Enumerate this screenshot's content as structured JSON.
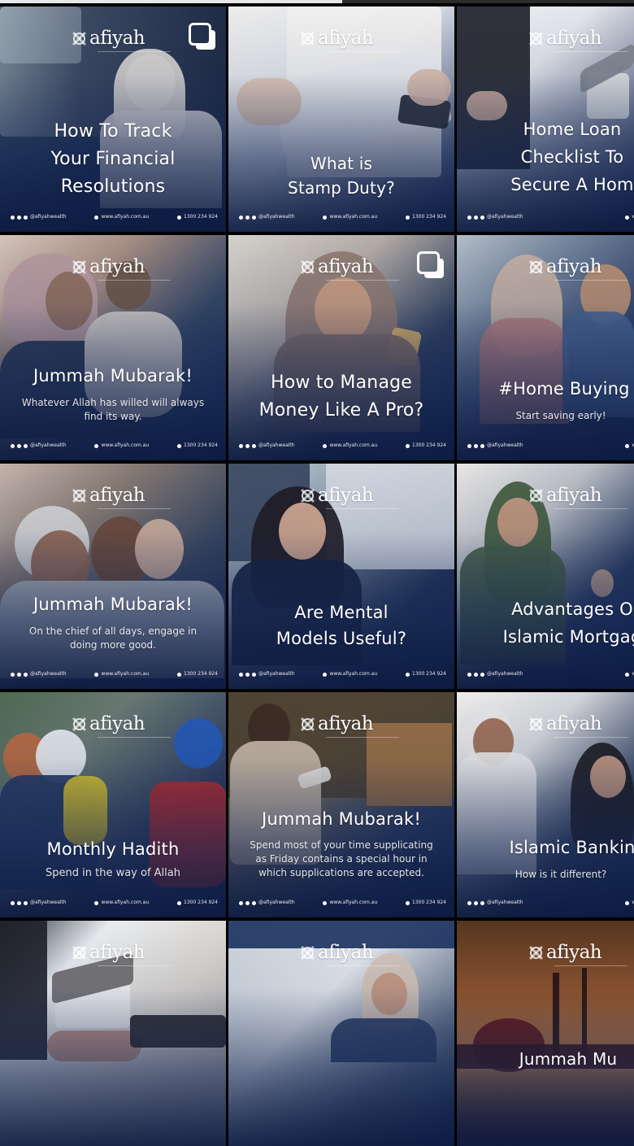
{
  "screen": {
    "progress_fraction": 0.54
  },
  "brand": {
    "name": "afiyah"
  },
  "footer": {
    "social": "@afiyahwealth",
    "website": "www.afiyah.com.au",
    "phone": "1300 234 924"
  },
  "icons": {
    "multi_post": "multi-post-icon",
    "brand_mark": "afiyah-logo-icon"
  },
  "posts": [
    {
      "title": "How To Track\nYour Financial\nResolutions",
      "subtitle": "",
      "multi": true
    },
    {
      "title": "What is\nStamp Duty?",
      "subtitle": "",
      "multi": false
    },
    {
      "title": "Home Loan\nChecklist To\nSecure A Hom",
      "subtitle": "",
      "multi": false
    },
    {
      "title": "Jummah Mubarak!",
      "subtitle": "Whatever Allah has willed will always\nfind its way.",
      "multi": false
    },
    {
      "title": "How to Manage\nMoney Like A Pro?",
      "subtitle": "",
      "multi": true
    },
    {
      "title": "#Home Buying T",
      "subtitle": "Start saving early!",
      "multi": false
    },
    {
      "title": "Jummah Mubarak!",
      "subtitle": "On the chief of all days, engage in\ndoing more good.",
      "multi": false
    },
    {
      "title": "Are Mental\nModels Useful?",
      "subtitle": "",
      "multi": false
    },
    {
      "title": "Advantages O\nIslamic Mortgag",
      "subtitle": "",
      "multi": false
    },
    {
      "title": "Monthly Hadith",
      "subtitle": "Spend in the way of Allah",
      "multi": false
    },
    {
      "title": "Jummah Mubarak!",
      "subtitle": "Spend most of your time supplicating\nas Friday contains a special hour in\nwhich supplications are accepted.",
      "multi": false
    },
    {
      "title": "Islamic Bankin",
      "subtitle": "How is it different?",
      "multi": false
    },
    {
      "title": "",
      "subtitle": "",
      "multi": false
    },
    {
      "title": "",
      "subtitle": "",
      "multi": false
    },
    {
      "title": "Jummah Mu",
      "subtitle": "",
      "multi": false
    }
  ]
}
